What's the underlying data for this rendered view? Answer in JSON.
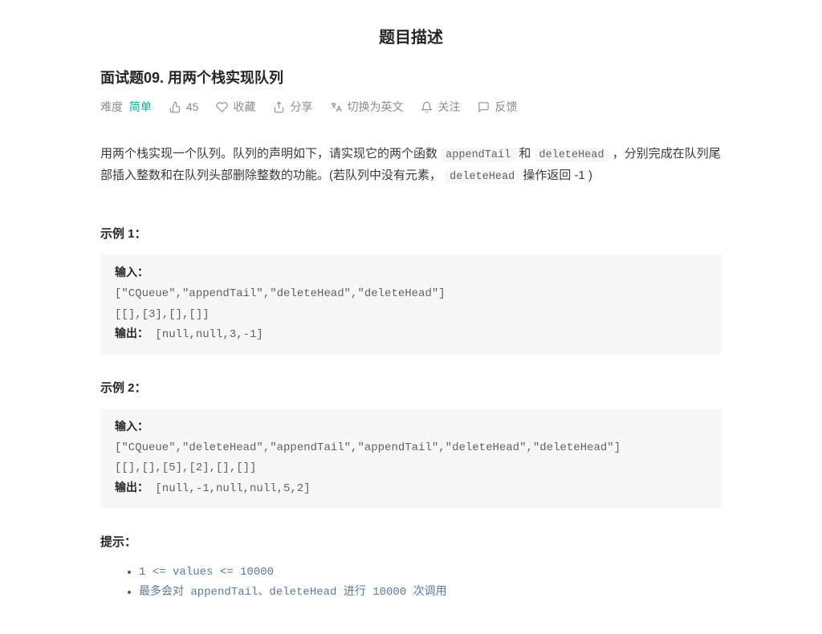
{
  "page_header": "题目描述",
  "problem": {
    "title": "面试题09. 用两个栈实现队列",
    "difficulty_label": "难度",
    "difficulty_value": "简单",
    "likes": "45",
    "favorite": "收藏",
    "share": "分享",
    "switch_lang": "切换为英文",
    "follow": "关注",
    "feedback": "反馈",
    "description_parts": {
      "t1": "用两个栈实现一个队列。队列的声明如下，请实现它的两个函数 ",
      "c1": "appendTail",
      "t2": " 和 ",
      "c2": "deleteHead",
      "t3": " ，分别完成在队列尾部插入整数和在队列头部删除整数的功能。(若队列中没有元素， ",
      "c3": "deleteHead",
      "t4": " 操作返回 -1 )"
    }
  },
  "examples": [
    {
      "label": "示例 1：",
      "input_label": "输入：",
      "input_lines": "[\"CQueue\",\"appendTail\",\"deleteHead\",\"deleteHead\"]\n[[],[3],[],[]]",
      "output_label": "输出：",
      "output_value": "[null,null,3,-1]"
    },
    {
      "label": "示例 2：",
      "input_label": "输入：",
      "input_lines": "[\"CQueue\",\"deleteHead\",\"appendTail\",\"appendTail\",\"deleteHead\",\"deleteHead\"]\n[[],[],[5],[2],[],[]]",
      "output_label": "输出：",
      "output_value": "[null,-1,null,null,5,2]"
    }
  ],
  "hints": {
    "label": "提示：",
    "items": [
      "1 <= values <= 10000",
      "最多会对 appendTail、deleteHead 进行 10000 次调用"
    ]
  }
}
